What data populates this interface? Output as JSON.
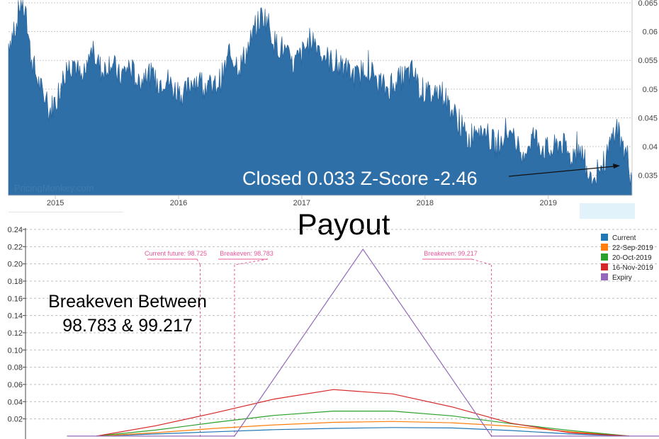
{
  "chart_data": [
    {
      "type": "area",
      "title": "",
      "xlabel": "",
      "ylabel": "",
      "x_ticks": [
        "2015",
        "2016",
        "2017",
        "2018",
        "2019"
      ],
      "y_ticks": [
        "0.035",
        "0.04",
        "0.045",
        "0.05",
        "0.055",
        "0.06",
        "0.065"
      ],
      "ylim": [
        0.0315,
        0.0655
      ],
      "xlim": [
        2014.62,
        2019.68
      ],
      "color": "#2f6fa7",
      "watermark": "PricingMonkey.com",
      "annotation": "Closed 0.033 Z-Score -2.46",
      "series": [
        {
          "x": [
            2014.62,
            2014.68,
            2014.72,
            2014.76,
            2014.8,
            2014.85,
            2014.9,
            2014.95,
            2015.0,
            2015.08,
            2015.15,
            2015.22,
            2015.3,
            2015.38,
            2015.45,
            2015.52,
            2015.6,
            2015.68,
            2015.75,
            2015.82,
            2015.9,
            2015.96,
            2016.05,
            2016.12,
            2016.2,
            2016.28,
            2016.35,
            2016.42,
            2016.5,
            2016.58,
            2016.63,
            2016.68,
            2016.72,
            2016.78,
            2016.85,
            2016.92,
            2017.0,
            2017.08,
            2017.15,
            2017.22,
            2017.3,
            2017.38,
            2017.45,
            2017.52,
            2017.6,
            2017.68,
            2017.75,
            2017.82,
            2017.9,
            2017.96,
            2018.05,
            2018.12,
            2018.2,
            2018.28,
            2018.35,
            2018.42,
            2018.5,
            2018.58,
            2018.65,
            2018.72,
            2018.8,
            2018.88,
            2018.95,
            2019.02,
            2019.1,
            2019.18,
            2019.25,
            2019.32,
            2019.38,
            2019.45,
            2019.5,
            2019.55,
            2019.6,
            2019.65,
            2019.68
          ],
          "y": [
            0.058,
            0.061,
            0.0655,
            0.063,
            0.056,
            0.052,
            0.049,
            0.046,
            0.048,
            0.053,
            0.055,
            0.051,
            0.057,
            0.053,
            0.055,
            0.052,
            0.054,
            0.051,
            0.053,
            0.051,
            0.052,
            0.05,
            0.049,
            0.052,
            0.051,
            0.05,
            0.052,
            0.056,
            0.054,
            0.058,
            0.061,
            0.063,
            0.062,
            0.058,
            0.057,
            0.054,
            0.056,
            0.059,
            0.057,
            0.055,
            0.054,
            0.053,
            0.052,
            0.054,
            0.052,
            0.05,
            0.051,
            0.052,
            0.053,
            0.05,
            0.049,
            0.05,
            0.047,
            0.044,
            0.041,
            0.044,
            0.042,
            0.04,
            0.043,
            0.041,
            0.039,
            0.042,
            0.04,
            0.039,
            0.041,
            0.038,
            0.04,
            0.036,
            0.035,
            0.037,
            0.04,
            0.044,
            0.04,
            0.038,
            0.033
          ]
        }
      ]
    },
    {
      "type": "line",
      "title": "Payout",
      "xlabel": "",
      "ylabel": "",
      "x": [
        98.55,
        98.65,
        98.75,
        98.85,
        98.95,
        99.05,
        99.15,
        99.25,
        99.35,
        99.45
      ],
      "xlim": [
        98.43,
        99.5
      ],
      "ylim": [
        -0.005,
        0.24
      ],
      "y_ticks": [
        "0.02",
        "0.04",
        "0.06",
        "0.08",
        "0.10",
        "0.12",
        "0.14",
        "0.16",
        "0.18",
        "0.20",
        "0.22",
        "0.24"
      ],
      "series": [
        {
          "name": "Current",
          "color": "#1f77b4",
          "values": [
            0.0,
            0.0025,
            0.005,
            0.0075,
            0.009,
            0.01,
            0.0095,
            0.0065,
            0.0025,
            0.0
          ]
        },
        {
          "name": "22-Sep-2019",
          "color": "#ff7f0e",
          "values": [
            0.0,
            0.004,
            0.009,
            0.013,
            0.016,
            0.017,
            0.0155,
            0.0115,
            0.005,
            0.0
          ]
        },
        {
          "name": "20-Oct-2019",
          "color": "#2ca02c",
          "values": [
            0.0,
            0.007,
            0.016,
            0.024,
            0.029,
            0.029,
            0.0235,
            0.0145,
            0.0065,
            0.0
          ]
        },
        {
          "name": "16-Nov-2019",
          "color": "#d62728",
          "values": [
            0.0,
            0.012,
            0.027,
            0.043,
            0.054,
            0.049,
            0.034,
            0.015,
            0.004,
            0.0
          ]
        }
      ],
      "expiry": {
        "name": "Expiry",
        "color": "#9467bd",
        "x": [
          98.5,
          98.783,
          99.0,
          99.217,
          99.5
        ],
        "values": [
          0.0,
          0.0,
          0.217,
          0.0,
          0.0
        ]
      },
      "reference_lines": [
        {
          "label": "Current future: 98.725",
          "x": 98.725
        },
        {
          "label": "Breakeven: 98.783",
          "x": 98.783
        },
        {
          "label": "Breakeven: 99.217",
          "x": 99.217
        }
      ],
      "annotation_lines": [
        "Breakeven Between",
        "98.783 & 99.217"
      ]
    }
  ]
}
